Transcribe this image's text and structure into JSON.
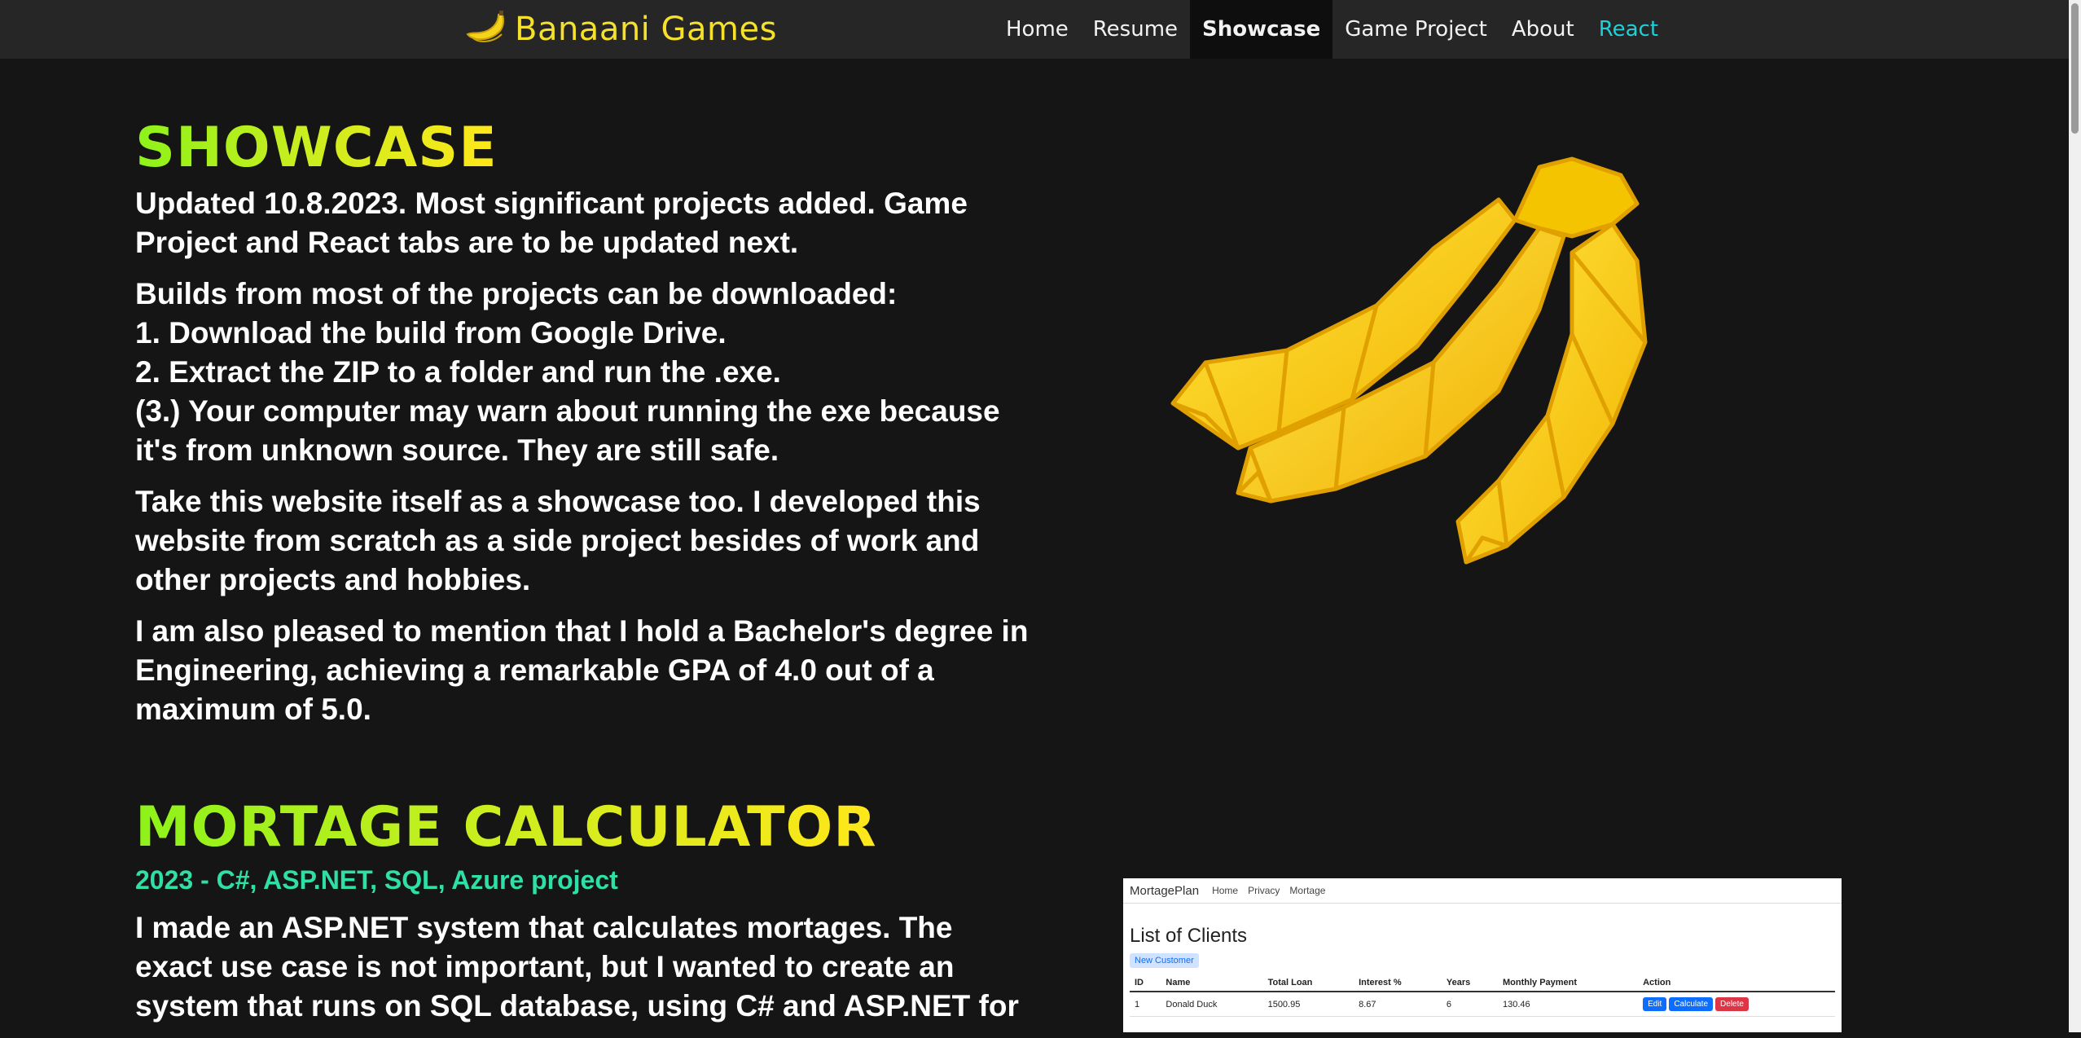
{
  "nav": {
    "brand": "Banaani Games",
    "links": [
      {
        "label": "Home"
      },
      {
        "label": "Resume"
      },
      {
        "label": "Showcase"
      },
      {
        "label": "Game Project"
      },
      {
        "label": "About"
      },
      {
        "label": "React"
      }
    ],
    "active": "Showcase"
  },
  "showcase": {
    "title": "SHOWCASE",
    "p1": [
      "Updated 10.8.2023. Most significant projects added. Game",
      "Project and React tabs are to be updated next."
    ],
    "p2": [
      "Builds from most of the projects can be downloaded:",
      "1. Download the build from Google Drive.",
      "2. Extract the ZIP to a folder and run the .exe.",
      "(3.) Your computer may warn about running the exe because",
      "it's from unknown source. They are still safe."
    ],
    "p3": [
      "Take this website itself as a showcase too. I developed this",
      "website from scratch as a side project besides of work and",
      "other projects and hobbies."
    ],
    "p4": [
      "I am also pleased to mention that I hold a Bachelor's degree in",
      "Engineering, achieving a remarkable GPA of 4.0 out of a",
      "maximum of 5.0."
    ]
  },
  "mortgage": {
    "title": "MORTAGE CALCULATOR",
    "subtitle": "2023 - C#, ASP.NET, SQL, Azure project",
    "p1": [
      "I made an ASP.NET system that calculates mortages. The",
      "exact use case is not important, but I wanted to create an",
      "system that runs on SQL database, using C# and ASP.NET for"
    ]
  },
  "mortgage_screenshot": {
    "brand": "MortagePlan",
    "links": [
      "Home",
      "Privacy",
      "Mortage"
    ],
    "title": "List of Clients",
    "new_button": "New Customer",
    "headers": [
      "ID",
      "Name",
      "Total Loan",
      "Interest %",
      "Years",
      "Monthly Payment",
      "Action"
    ],
    "row": {
      "id": "1",
      "name": "Donald Duck",
      "loan": "1500.95",
      "interest": "8.67",
      "years": "6",
      "payment": "130.46"
    },
    "actions": [
      "Edit",
      "Calculate",
      "Delete"
    ]
  },
  "colors": {
    "brand": "#f5e12a",
    "react_link": "#20d0d9",
    "subtitle": "#2fe0a6",
    "background": "#151515",
    "navbar": "#262626"
  },
  "icons": {
    "brand_icon": "banana-icon",
    "hero_image": "banana-bunch-illustration"
  }
}
